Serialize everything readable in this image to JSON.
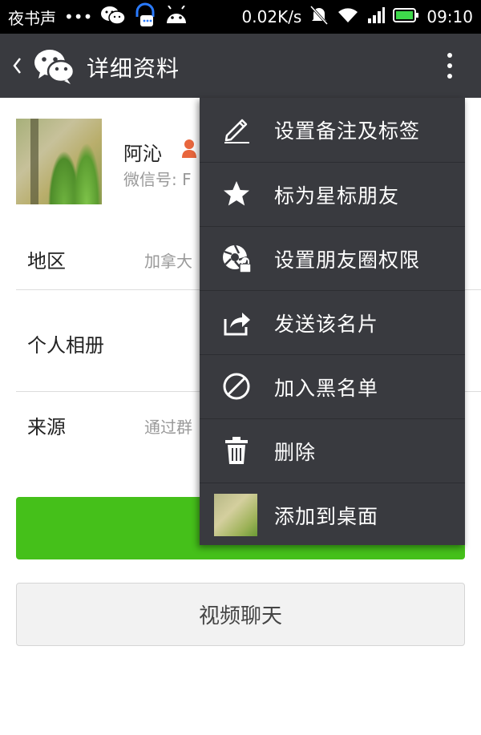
{
  "status_bar": {
    "app_label": "夜书声",
    "dots": "•••",
    "speed": "0.02K/s",
    "time": "09:10"
  },
  "title_bar": {
    "title": "详细资料"
  },
  "profile": {
    "name": "阿沁",
    "wechat_id": "微信号: F"
  },
  "info_rows": [
    {
      "label": "地区",
      "value": "加拿大"
    },
    {
      "label": "个人相册",
      "value": ""
    },
    {
      "label": "来源",
      "value": "通过群"
    }
  ],
  "buttons": {
    "video_chat": "视频聊天"
  },
  "menu": {
    "items": [
      {
        "label": "设置备注及标签",
        "icon": "pencil-icon"
      },
      {
        "label": "标为星标朋友",
        "icon": "star-icon"
      },
      {
        "label": "设置朋友圈权限",
        "icon": "moments-lock-icon"
      },
      {
        "label": "发送该名片",
        "icon": "share-icon"
      },
      {
        "label": "加入黑名单",
        "icon": "block-icon"
      },
      {
        "label": "删除",
        "icon": "trash-icon"
      },
      {
        "label": "添加到桌面",
        "icon": "desktop-thumbnail"
      }
    ]
  },
  "colors": {
    "title_bar_bg": "#393a3f",
    "accent_green": "#45c01a"
  }
}
